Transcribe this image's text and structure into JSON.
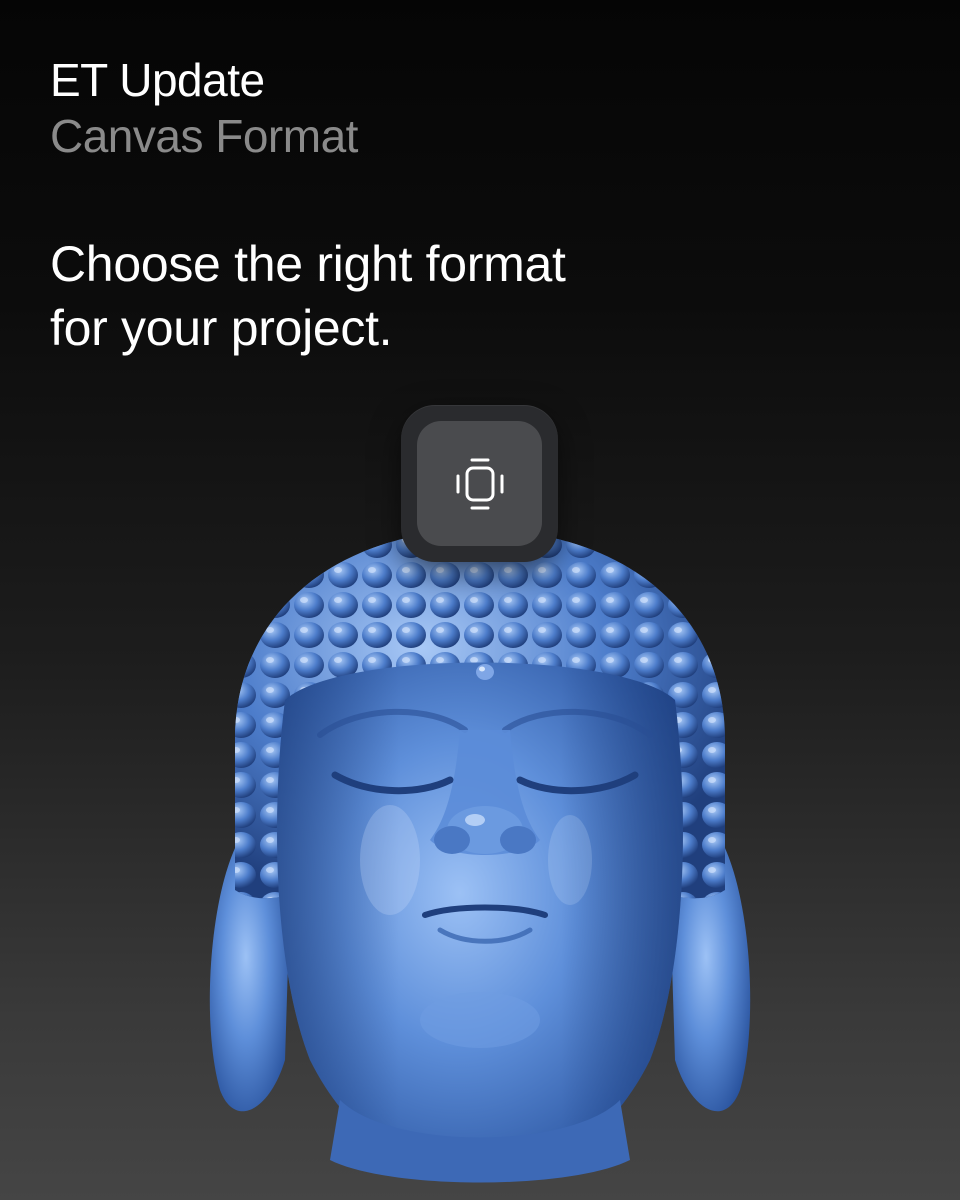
{
  "header": {
    "title": "ET Update",
    "subtitle": "Canvas Format"
  },
  "tagline": {
    "line1": "Choose the right format",
    "line2": "for your project."
  },
  "format_button": {
    "icon": "canvas-format-icon"
  },
  "image": {
    "subject": "buddha-head-sculpture"
  },
  "colors": {
    "title": "#ffffff",
    "subtitle": "#8a8a8a",
    "button_outer": "#2a2b2e",
    "button_inner": "#4a4b4e",
    "sculpture": "#4f7fcf"
  }
}
